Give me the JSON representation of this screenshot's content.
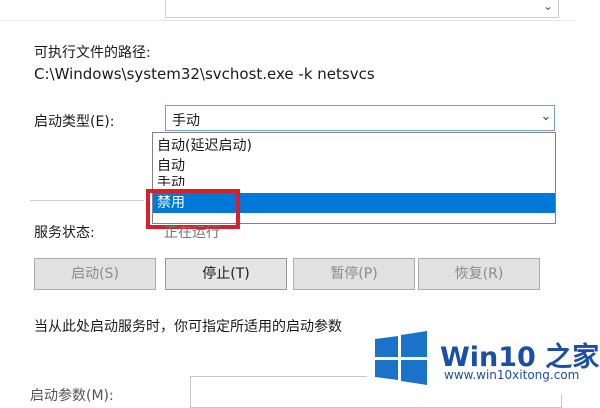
{
  "path": {
    "label": "可执行文件的路径:",
    "value": "C:\\Windows\\system32\\svchost.exe -k netsvcs"
  },
  "startup_type": {
    "label": "启动类型(E):",
    "selected": "手动",
    "options": [
      "自动(延迟启动)",
      "自动",
      "手动",
      "禁用"
    ],
    "highlighted": "禁用"
  },
  "service_status": {
    "label": "服务状态:",
    "value": "正在运行"
  },
  "buttons": {
    "start": "启动(S)",
    "stop": "停止(T)",
    "pause": "暂停(P)",
    "resume": "恢复(R)"
  },
  "hint": "当从此处启动服务时，你可指定所适用的启动参数",
  "params_label": "启动参数(M):",
  "watermark": {
    "brand": "Win10 之家",
    "site": "www.win10xitong.com"
  },
  "colors": {
    "selection": "#0078d7",
    "highlight_box": "#d5212a",
    "brand": "#1a4fa3"
  },
  "icons": [
    "chevron-down-icon",
    "windows-logo-icon"
  ]
}
